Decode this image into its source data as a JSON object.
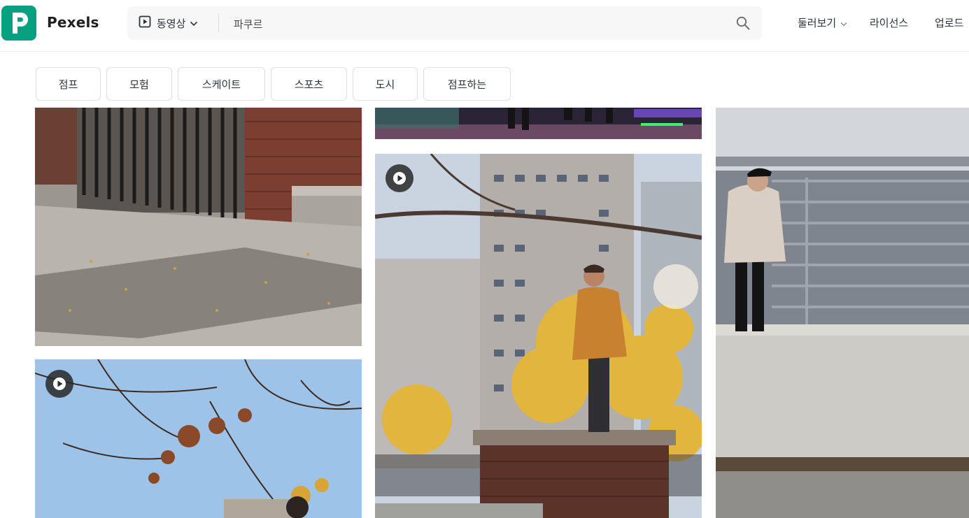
{
  "brand": {
    "name": "Pexels",
    "logo_letter": "P",
    "color": "#07a081"
  },
  "search": {
    "type_label": "동영상",
    "value": "파쿠르",
    "icons": {
      "type": "play-square-icon",
      "dropdown": "chevron-down-icon",
      "submit": "search-icon"
    }
  },
  "nav": {
    "browse": "둘러보기",
    "license": "라이선스",
    "upload": "업로드"
  },
  "chips": [
    "점프",
    "모험",
    "스케이트",
    "스포츠",
    "도시",
    "점프하는"
  ],
  "tiles": [
    {
      "scene": "brick wall with iron fence and sunny pavement",
      "play": false
    },
    {
      "scene": "night skate rink with neon lights",
      "play": false
    },
    {
      "scene": "man in orange sweater on brick wall in autumn city",
      "play": true
    },
    {
      "scene": "man in hoodie walking on bridge railing by river",
      "play": false
    },
    {
      "scene": "person under autumn tree branches against blue sky",
      "play": true
    }
  ]
}
